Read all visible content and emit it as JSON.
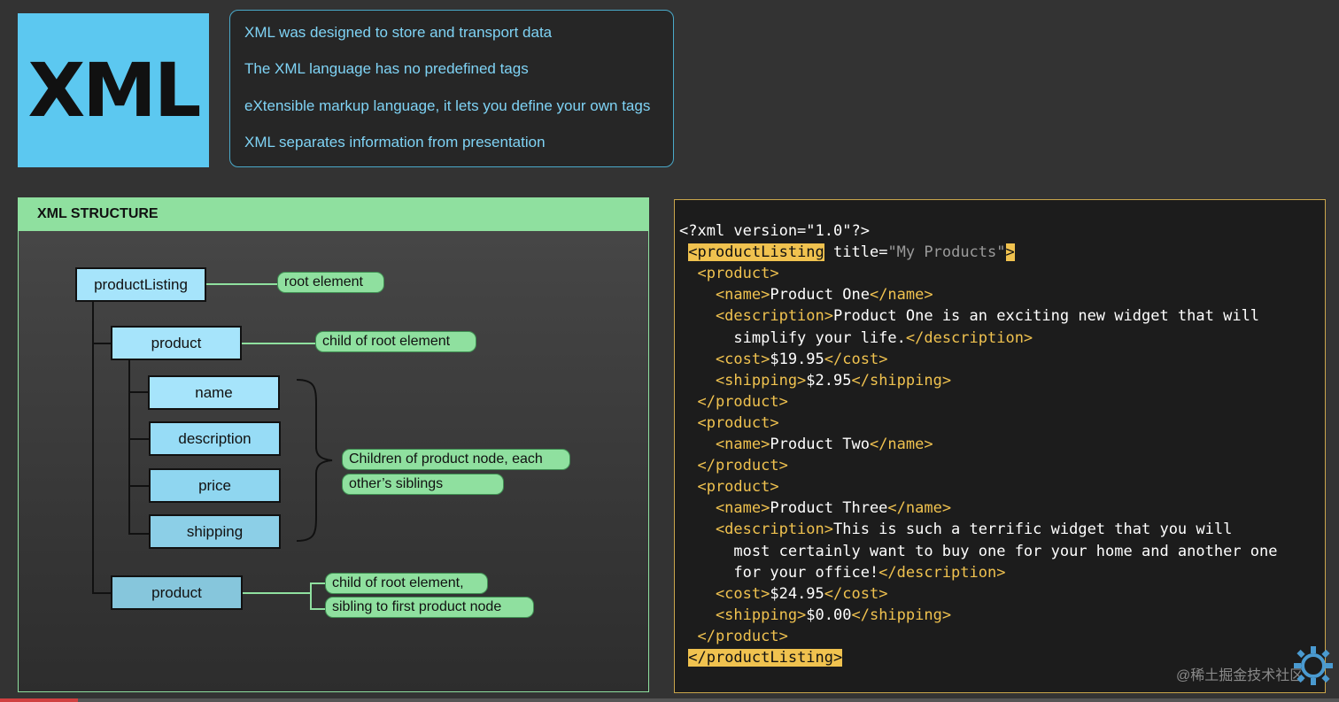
{
  "logo": {
    "text": "XML"
  },
  "facts": [
    "XML was designed to store and transport data",
    "The XML language has no predefined tags",
    "eXtensible markup language, it lets you define your own tags",
    "XML separates information from presentation"
  ],
  "structure": {
    "title": "XML STRUCTURE",
    "nodes": {
      "root": "productListing",
      "product1": "product",
      "name": "name",
      "description": "description",
      "price": "price",
      "shipping": "shipping",
      "product2": "product"
    },
    "labels": {
      "root": "root element",
      "child": "child of root element",
      "children_line1": "Children of product node, each",
      "children_line2": "other’s siblings",
      "sibling_line1": "child of root element,",
      "sibling_line2": "sibling to first product node"
    },
    "colors": {
      "node_light": "#a6e4fb",
      "node_mid": "#8fd6f0",
      "node_dark": "#86c6dc",
      "accent_green": "#8fe09f",
      "code_tag": "#f0c24f"
    }
  },
  "code": {
    "lines": [
      [
        {
          "t": "<?xml version=\"1.0\"?>",
          "c": "pi"
        }
      ],
      [
        {
          "t": " ",
          "c": "txt"
        },
        {
          "t": "<productListing",
          "c": "hl"
        },
        {
          "t": " title=",
          "c": "attr"
        },
        {
          "t": "\"My Products\"",
          "c": "str"
        },
        {
          "t": ">",
          "c": "hl"
        }
      ],
      [
        {
          "t": "  <product>",
          "c": "tag"
        }
      ],
      [
        {
          "t": "    <name>",
          "c": "tag"
        },
        {
          "t": "Product One",
          "c": "txt"
        },
        {
          "t": "</name>",
          "c": "tag"
        }
      ],
      [
        {
          "t": "    <description>",
          "c": "tag"
        },
        {
          "t": "Product One is an exciting new widget that will",
          "c": "txt"
        }
      ],
      [
        {
          "t": "      simplify your life.",
          "c": "txt"
        },
        {
          "t": "</description>",
          "c": "tag"
        }
      ],
      [
        {
          "t": "    <cost>",
          "c": "tag"
        },
        {
          "t": "$19.95",
          "c": "txt"
        },
        {
          "t": "</cost>",
          "c": "tag"
        }
      ],
      [
        {
          "t": "    <shipping>",
          "c": "tag"
        },
        {
          "t": "$2.95",
          "c": "txt"
        },
        {
          "t": "</shipping>",
          "c": "tag"
        }
      ],
      [
        {
          "t": "  </product>",
          "c": "tag"
        }
      ],
      [
        {
          "t": "  <product>",
          "c": "tag"
        }
      ],
      [
        {
          "t": "    <name>",
          "c": "tag"
        },
        {
          "t": "Product Two",
          "c": "txt"
        },
        {
          "t": "</name>",
          "c": "tag"
        }
      ],
      [
        {
          "t": "  </product>",
          "c": "tag"
        }
      ],
      [
        {
          "t": "  <product>",
          "c": "tag"
        }
      ],
      [
        {
          "t": "    <name>",
          "c": "tag"
        },
        {
          "t": "Product Three",
          "c": "txt"
        },
        {
          "t": "</name>",
          "c": "tag"
        }
      ],
      [
        {
          "t": "    <description>",
          "c": "tag"
        },
        {
          "t": "This is such a terrific widget that you will",
          "c": "txt"
        }
      ],
      [
        {
          "t": "      most certainly want to buy one for your home and another one",
          "c": "txt"
        }
      ],
      [
        {
          "t": "      for your office!",
          "c": "txt"
        },
        {
          "t": "</description>",
          "c": "tag"
        }
      ],
      [
        {
          "t": "    <cost>",
          "c": "tag"
        },
        {
          "t": "$24.95",
          "c": "txt"
        },
        {
          "t": "</cost>",
          "c": "tag"
        }
      ],
      [
        {
          "t": "    <shipping>",
          "c": "tag"
        },
        {
          "t": "$0.00",
          "c": "txt"
        },
        {
          "t": "</shipping>",
          "c": "tag"
        }
      ],
      [
        {
          "t": "  </product>",
          "c": "tag"
        }
      ],
      [
        {
          "t": " ",
          "c": "txt"
        },
        {
          "t": "</productListing>",
          "c": "hl"
        }
      ]
    ]
  },
  "watermark": "@稀土掘金技术社区",
  "icons": {
    "corner": "gear-icon"
  }
}
